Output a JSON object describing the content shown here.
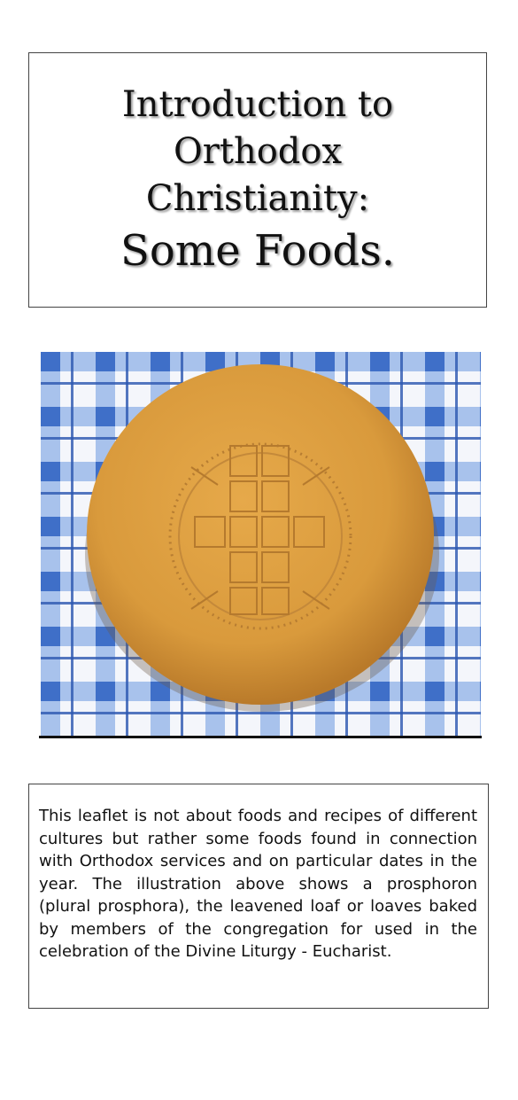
{
  "title": {
    "line1": "Introduction to",
    "line2": "Orthodox",
    "line3": "Christianity:",
    "line4": "Some Foods."
  },
  "image": {
    "subject": "prosphoron loaf on blue checked cloth",
    "colors": {
      "bread": "#d99a3c",
      "cloth_blue": "#3f6fc8",
      "cloth_white": "#f4f6fb"
    }
  },
  "body": {
    "text": "This leaflet is not about foods and recipes of different cultures but rather some foods found in connection with Orthodox services and on particular dates in the year.  The illustration above shows a prosphoron (plural prosphora), the leavened loaf or loaves baked by members of the congregation for used in the celebration of the Divine Liturgy - Eucharist."
  }
}
